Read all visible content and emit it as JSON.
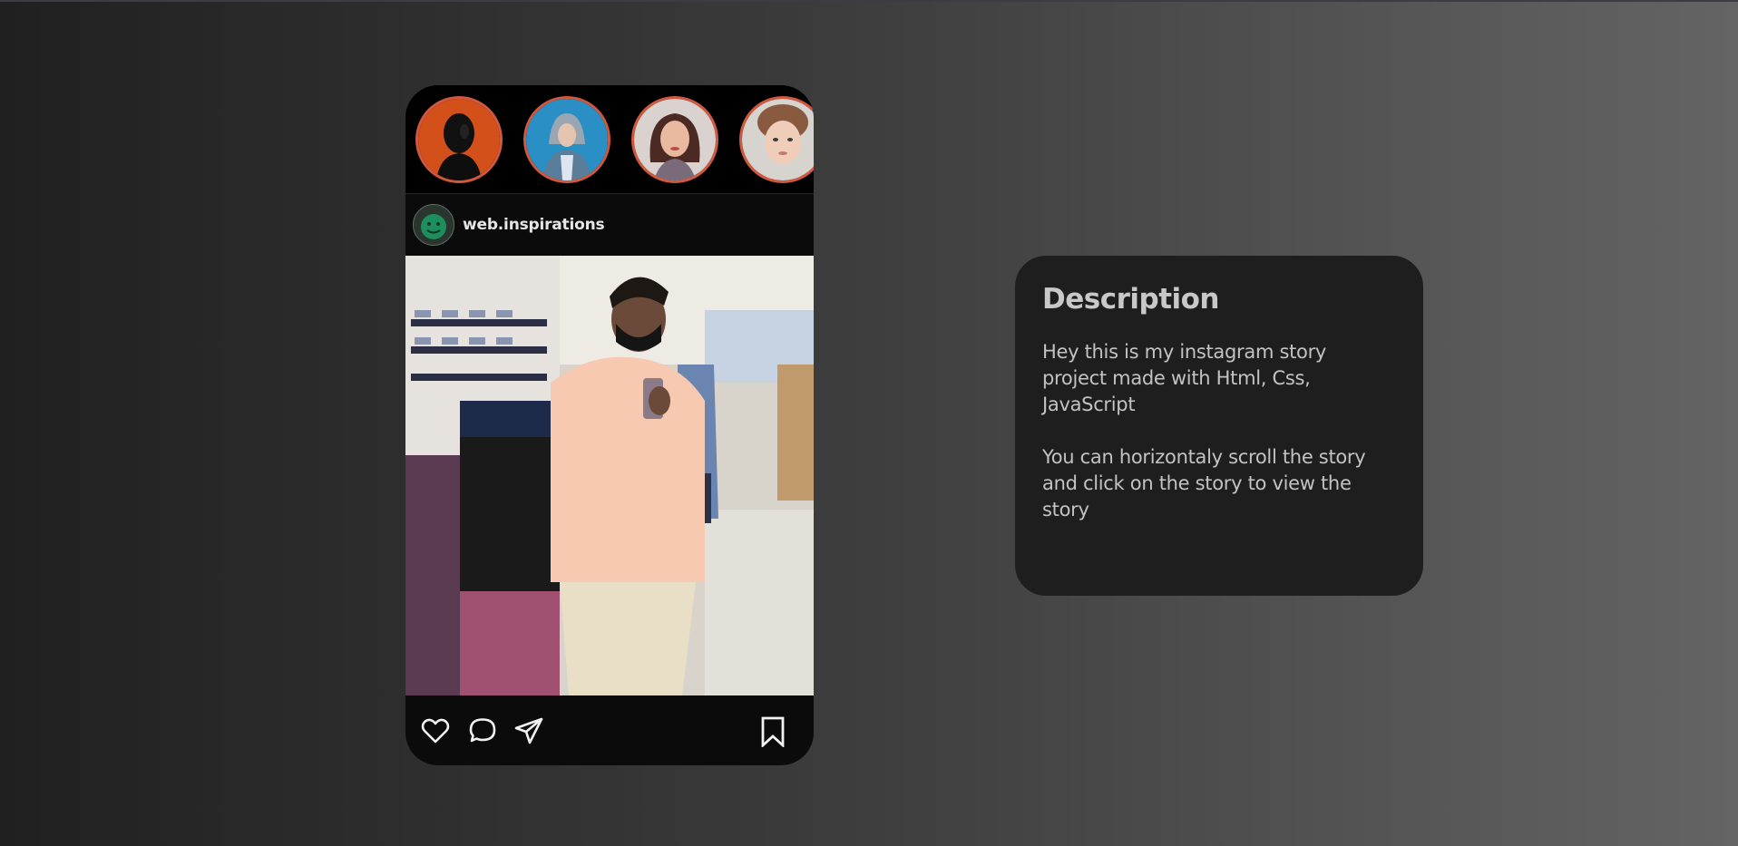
{
  "feed": {
    "stories": [
      {
        "name": "story-1",
        "icon": "avatar-silhouette",
        "ring_color": "#d0583e"
      },
      {
        "name": "story-2",
        "icon": "avatar-hooded",
        "ring_color": "#d0583e"
      },
      {
        "name": "story-3",
        "icon": "avatar-woman-dark-hair",
        "ring_color": "#d0583e"
      },
      {
        "name": "story-4",
        "icon": "avatar-woman-curly-hair",
        "ring_color": "#d0583e"
      }
    ],
    "post": {
      "username": "web.inspirations",
      "image_icon": "mirror-selfie-photo",
      "actions": [
        "heart-icon",
        "comment-icon",
        "share-icon"
      ],
      "save_icon": "bookmark-icon"
    }
  },
  "description": {
    "title": "Description",
    "paragraph1": "Hey this is my instagram story project made with Html, Css, JavaScript",
    "paragraph2": "You can horizontaly scroll the story and click on the story to view the story"
  },
  "colors": {
    "story_ring": "#d0583e",
    "card_bg": "#1e1e1e",
    "phone_bg": "#0b0b0b"
  }
}
